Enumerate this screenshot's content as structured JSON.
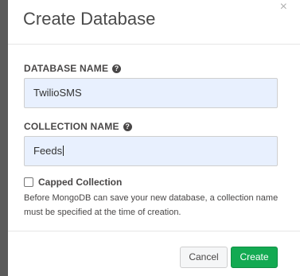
{
  "dialog": {
    "title": "Create Database",
    "close_glyph": "×"
  },
  "database_name": {
    "label": "DATABASE NAME",
    "value": "TwilioSMS"
  },
  "collection_name": {
    "label": "COLLECTION NAME",
    "value": "Feeds"
  },
  "capped": {
    "label": "Capped Collection",
    "checked": false
  },
  "help_text": "Before MongoDB can save your new database, a collection name must be specified at the time of creation.",
  "buttons": {
    "cancel": "Cancel",
    "create": "Create"
  },
  "colors": {
    "primary": "#13aa52",
    "input_bg": "#e8f0fe",
    "text": "#494747"
  },
  "icons": {
    "help": "question-circle-icon"
  }
}
